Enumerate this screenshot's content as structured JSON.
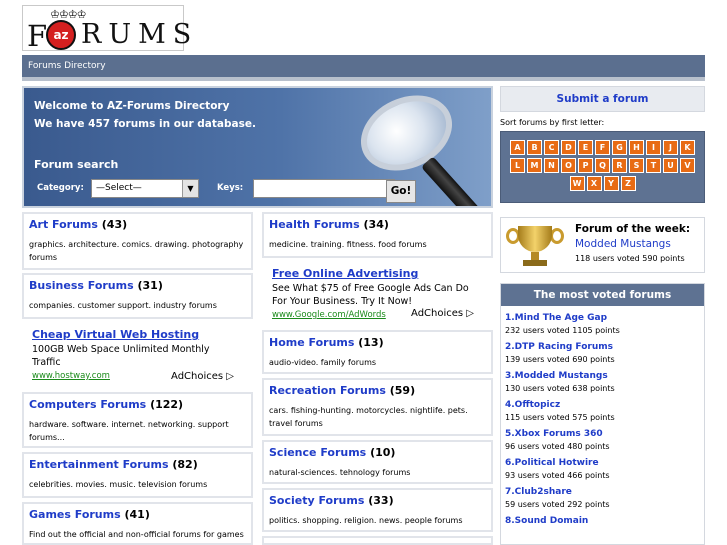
{
  "logo": {
    "az": "az",
    "f": "F",
    "rums": "RUMS",
    "crown": "♔♔♔♔"
  },
  "nav": {
    "breadcrumb": "Forums Directory"
  },
  "hero": {
    "welcome": "Welcome to AZ-Forums Directory",
    "count_line": "We have 457 forums in our database.",
    "search_title": "Forum search",
    "category_label": "Category:",
    "category_value": "—Select—",
    "keys_label": "Keys:",
    "keys_value": "",
    "go_label": "Go!"
  },
  "left_col": {
    "art": {
      "name": "Art Forums",
      "count": "(43)",
      "desc": "graphics. architecture. comics. drawing. photography forums"
    },
    "business": {
      "name": "Business Forums",
      "count": "(31)",
      "desc": "companies. customer support. industry forums"
    },
    "ad": {
      "title": "Cheap Virtual Web Hosting",
      "body": "100GB Web Space Unlimited Monthly Traffic",
      "url": "www.hostway.com",
      "choices": "AdChoices ▷"
    },
    "computers": {
      "name": "Computers Forums",
      "count": "(122)",
      "desc": "hardware. software. internet. networking. support forums..."
    },
    "entertainment": {
      "name": "Entertainment Forums",
      "count": "(82)",
      "desc": "celebrities. movies. music. television forums"
    },
    "games": {
      "name": "Games Forums",
      "count": "(41)",
      "desc": "Find out the official and non-official forums for games"
    }
  },
  "mid_col": {
    "health": {
      "name": "Health Forums",
      "count": "(34)",
      "desc": "medicine. training. fitness. food forums"
    },
    "ad": {
      "title": "Free Online Advertising",
      "body": "See What $75 of Free Google Ads Can Do For Your Business. Try It Now!",
      "url": "www.Google.com/AdWords",
      "choices": "AdChoices ▷"
    },
    "home": {
      "name": "Home Forums",
      "count": "(13)",
      "desc": "audio-video. family forums"
    },
    "recreation": {
      "name": "Recreation Forums",
      "count": "(59)",
      "desc": "cars. fishing-hunting. motorcycles. nightlife. pets. travel forums"
    },
    "science": {
      "name": "Science Forums",
      "count": "(10)",
      "desc": "natural-sciences. tehnology forums"
    },
    "society": {
      "name": "Society Forums",
      "count": "(33)",
      "desc": "politics. shopping. religion. news. people forums"
    }
  },
  "sidebar": {
    "submit_label": "Submit a forum",
    "sort_label": "Sort forums by first letter:",
    "letters_row1": [
      "A",
      "B",
      "C",
      "D",
      "E",
      "F",
      "G",
      "H",
      "I",
      "J",
      "K"
    ],
    "letters_row2": [
      "L",
      "M",
      "N",
      "O",
      "P",
      "Q",
      "R",
      "S",
      "T",
      "U",
      "V"
    ],
    "letters_row3": [
      "W",
      "X",
      "Y",
      "Z"
    ],
    "forum_of_week": {
      "label": "Forum of the week:",
      "name": "Modded Mustangs",
      "votes": "118 users voted 590 points"
    },
    "most_voted": {
      "title": "The most voted forums",
      "items": [
        {
          "name": "1.Mind The Age Gap",
          "votes": "232 users voted 1105 points"
        },
        {
          "name": "2.DTP Racing Forums",
          "votes": "139 users voted 690 points"
        },
        {
          "name": "3.Modded Mustangs",
          "votes": "130 users voted 638 points"
        },
        {
          "name": "4.Offtopicz",
          "votes": "115 users voted 575 points"
        },
        {
          "name": "5.Xbox Forums 360",
          "votes": "96 users voted 480 points"
        },
        {
          "name": "6.Political Hotwire",
          "votes": "93 users voted 466 points"
        },
        {
          "name": "7.Club2share",
          "votes": "59 users voted 292 points"
        },
        {
          "name": "8.Sound Domain",
          "votes": ""
        }
      ]
    }
  }
}
